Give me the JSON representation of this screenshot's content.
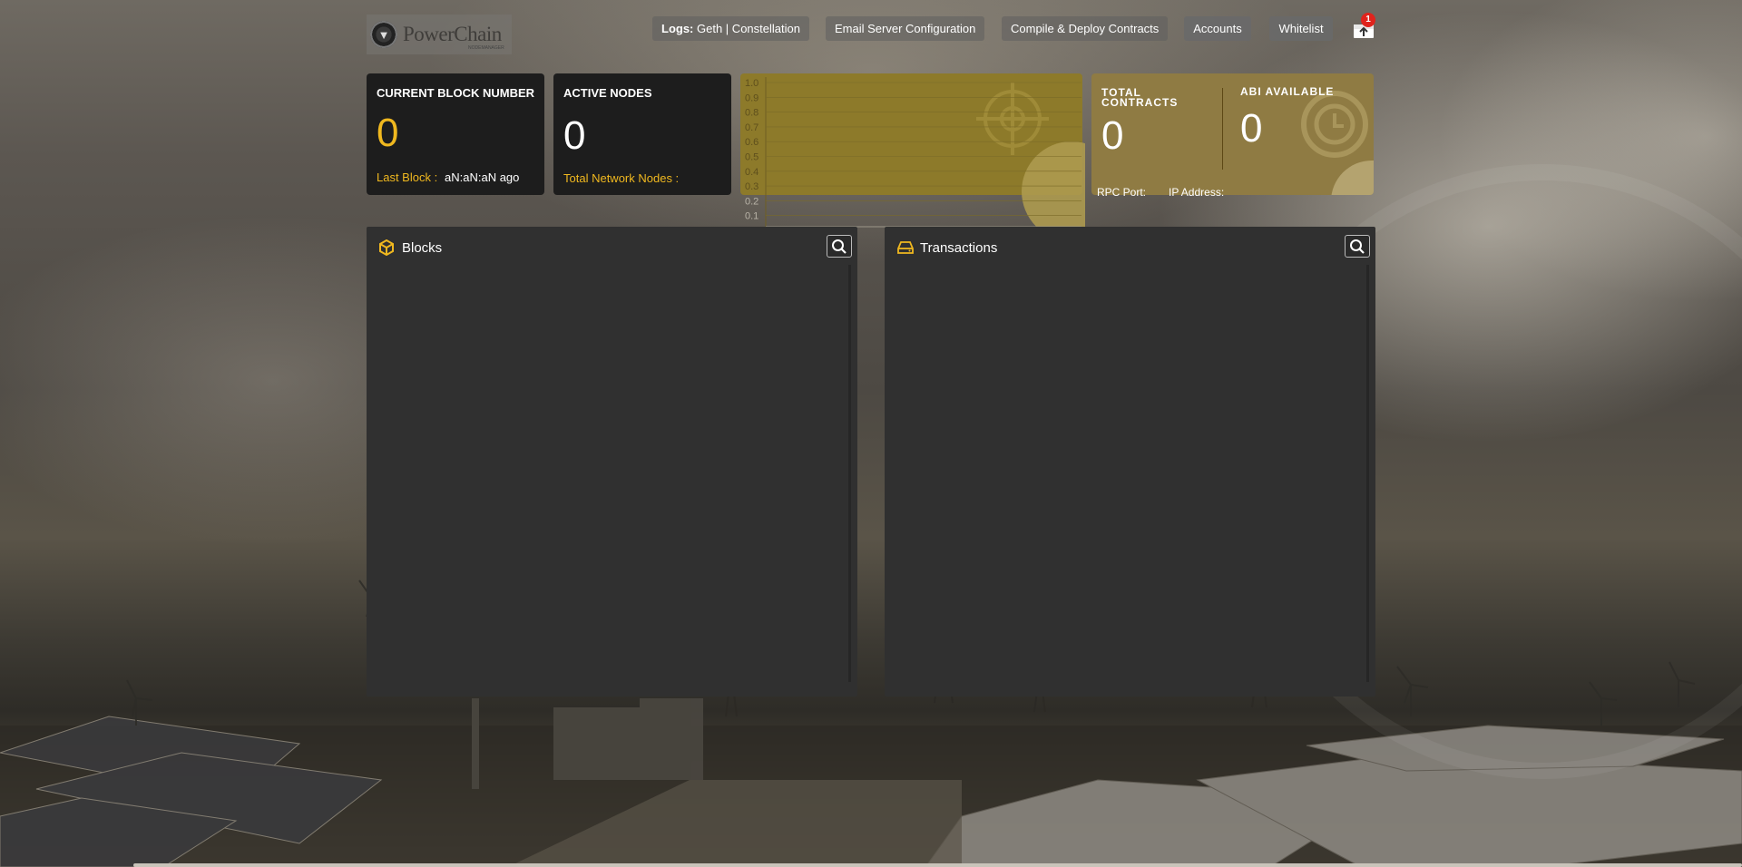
{
  "header": {
    "logo_text": "PowerChain",
    "logo_sub": "NODEMANAGER",
    "nav": [
      {
        "label": "Geth | Constellation",
        "prefix": "Logs:"
      },
      {
        "label": "Email Server Configuration"
      },
      {
        "label": "Compile & Deploy Contracts"
      },
      {
        "label": "Accounts"
      },
      {
        "label": "Whitelist"
      }
    ],
    "notification_count": "1"
  },
  "cards": {
    "block": {
      "title": "CURRENT BLOCK NUMBER",
      "value": "0",
      "last_label": "Last Block :",
      "last_value": "aN:aN:aN ago"
    },
    "nodes": {
      "title": "ACTIVE NODES",
      "value": "0",
      "total_label": "Total Network Nodes :"
    },
    "contracts": {
      "title": "TOTAL CONTRACTS",
      "value": "0",
      "rpc_label": "RPC Port:"
    },
    "abi": {
      "title": "ABI AVAILABLE",
      "value": "0",
      "ip_label": "IP Address:"
    }
  },
  "chart_data": {
    "type": "line",
    "yticks": [
      "1.0",
      "0.9",
      "0.8",
      "0.7",
      "0.6",
      "0.5",
      "0.4",
      "0.3",
      "0.2",
      "0.1"
    ],
    "ylim": [
      0,
      1.0
    ],
    "series": [],
    "grid": true
  },
  "panels": {
    "blocks": {
      "title": "Blocks"
    },
    "transactions": {
      "title": "Transactions"
    }
  },
  "colors": {
    "accent": "#f0b81f",
    "card_dark": "#1d1d1d",
    "chart_bg": "#8d7a2a",
    "contracts_bg": "#8f7b43",
    "panel_bg": "#303030",
    "badge": "#e0231c"
  }
}
